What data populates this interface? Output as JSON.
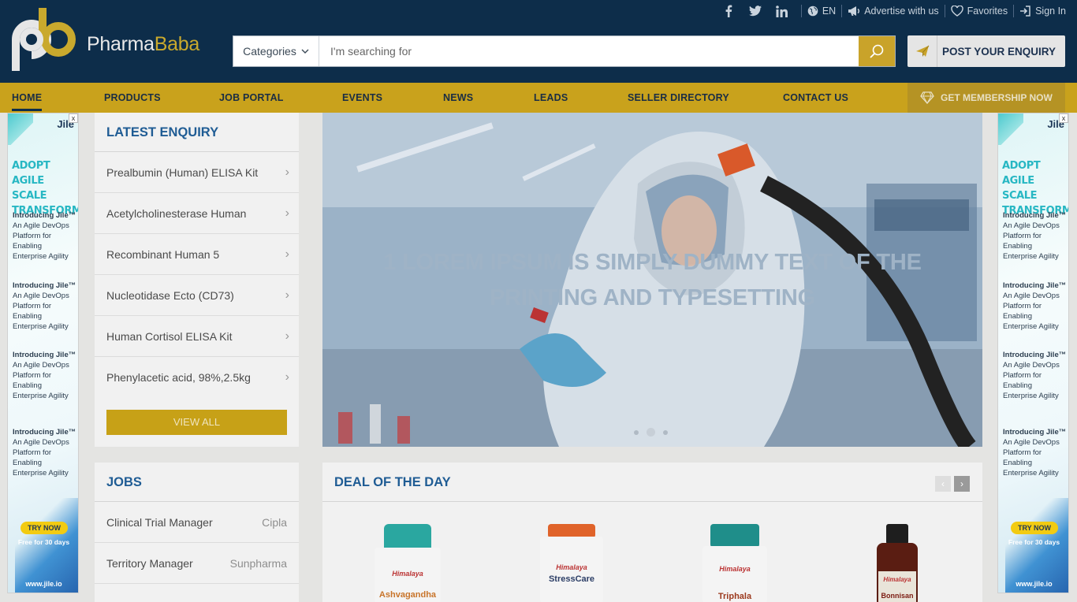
{
  "brand": {
    "name_part1": "Pharma",
    "name_part2": "Baba"
  },
  "topbar": {
    "social": [
      "facebook-icon",
      "twitter-icon",
      "linkedin-icon"
    ],
    "language": "EN",
    "advertise": "Advertise with us",
    "favorites": "Favorites",
    "signin": "Sign In"
  },
  "search": {
    "category_label": "Categories",
    "placeholder": "I'm searching for"
  },
  "post_enquiry": "POST YOUR ENQUIRY",
  "nav": {
    "items": [
      "HOME",
      "PRODUCTS",
      "JOB PORTAL",
      "EVENTS",
      "NEWS",
      "LEADS",
      "SELLER DIRECTORY",
      "CONTACT US"
    ],
    "membership": "GET MEMBERSHIP NOW"
  },
  "ad": {
    "brand": "Jile",
    "close": "x",
    "headline": [
      "ADOPT AGILE",
      "SCALE",
      "TRANSFORM"
    ],
    "blurb_title": "Introducing Jile™",
    "blurb_lines": [
      "An Agile DevOps",
      "Platform for",
      "Enabling",
      "Enterprise Agility"
    ],
    "cta": "TRY NOW",
    "free": "Free for 30 days",
    "url": "www.jile.io"
  },
  "latest_enquiry": {
    "title": "LATEST ENQUIRY",
    "items": [
      "Prealbumin (Human) ELISA Kit",
      "Acetylcholinesterase Human",
      "Recombinant Human 5",
      "Nucleotidase Ecto (CD73)",
      "Human Cortisol ELISA Kit",
      "Phenylacetic acid, 98%,2.5kg"
    ],
    "view_all": "VIEW ALL"
  },
  "hero": {
    "caption_line1": "1 LOREM IPSUM IS SIMPLY DUMMY TEXT OF THE",
    "caption_line2": "PRINTING AND TYPESETTING",
    "slide_count": 3,
    "active_slide": 2
  },
  "jobs": {
    "title": "JOBS",
    "items": [
      {
        "role": "Clinical Trial Manager",
        "company": "Cipla"
      },
      {
        "role": "Territory Manager",
        "company": "Sunpharma"
      }
    ]
  },
  "deal": {
    "title": "DEAL OF THE DAY",
    "products": [
      {
        "brand": "Himalaya",
        "name": "Ashvagandha",
        "cap_color": "#2aa7a0",
        "label_color": "#e8a33a"
      },
      {
        "brand": "Himalaya",
        "name": "StressCare",
        "cap_color": "#e0632a",
        "label_color": "#6b8cc8"
      },
      {
        "brand": "Himalaya",
        "name": "Triphala",
        "cap_color": "#1f8e8a",
        "label_color": "#c7d845"
      },
      {
        "brand": "Himalaya",
        "name": "Bonnisan",
        "cap_color": "#1e1e1e",
        "label_color": "#c23a2c"
      }
    ]
  }
}
